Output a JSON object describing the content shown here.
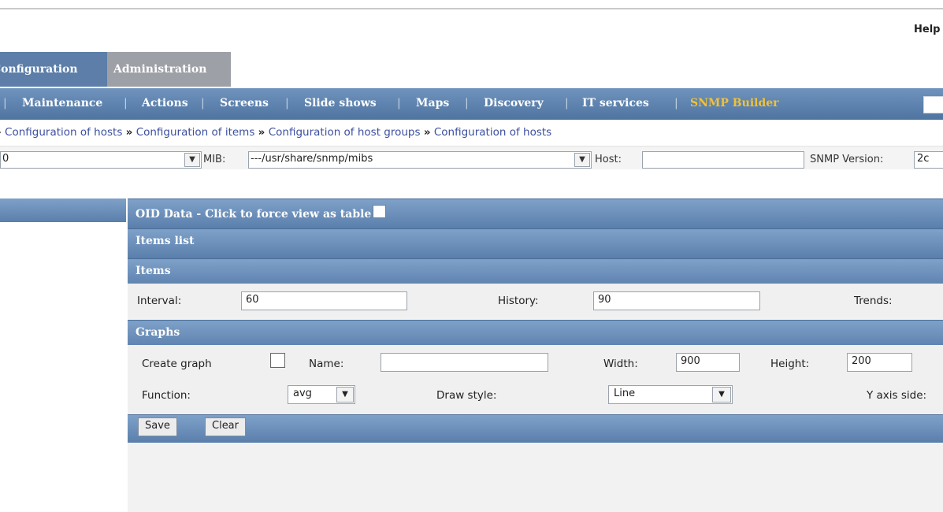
{
  "header": {
    "help_label": "Help"
  },
  "main_tabs": [
    {
      "label": "Configuration"
    },
    {
      "label": "Administration"
    }
  ],
  "sub_nav": {
    "items": [
      "Maintenance",
      "Actions",
      "Screens",
      "Slide shows",
      "Maps",
      "Discovery",
      "IT services",
      "SNMP Builder"
    ],
    "active": "SNMP Builder",
    "separator": "|",
    "active_color": "#f0c23a"
  },
  "breadcrumbs": {
    "items": [
      "Configuration of hosts",
      "Configuration of items",
      "Configuration of host groups",
      "Configuration of hosts"
    ],
    "separator": "»"
  },
  "filter": {
    "first_select_value": "0",
    "mib_label": "MIB:",
    "mib_value": "---/usr/share/snmp/mibs",
    "host_label": "Host:",
    "host_value": "",
    "snmp_version_label": "SNMP Version:",
    "snmp_version_value": "2c"
  },
  "sections": {
    "oid_data": "OID Data - Click to force view as table",
    "items_list": "Items list",
    "items": "Items",
    "graphs": "Graphs"
  },
  "items_form": {
    "interval_label": "Interval:",
    "interval_value": "60",
    "history_label": "History:",
    "history_value": "90",
    "trends_label": "Trends:"
  },
  "graphs_form": {
    "create_graph_label": "Create graph",
    "name_label": "Name:",
    "name_value": "",
    "width_label": "Width:",
    "width_value": "900",
    "height_label": "Height:",
    "height_value": "200",
    "function_label": "Function:",
    "function_value": "avg",
    "draw_style_label": "Draw style:",
    "draw_style_value": "Line",
    "y_axis_side_label": "Y axis side:"
  },
  "buttons": {
    "save": "Save",
    "clear": "Clear"
  },
  "colors": {
    "band_blue": "#5a7fab",
    "tab_active": "#5c7ea8",
    "tab_inactive": "#9da0a6"
  }
}
